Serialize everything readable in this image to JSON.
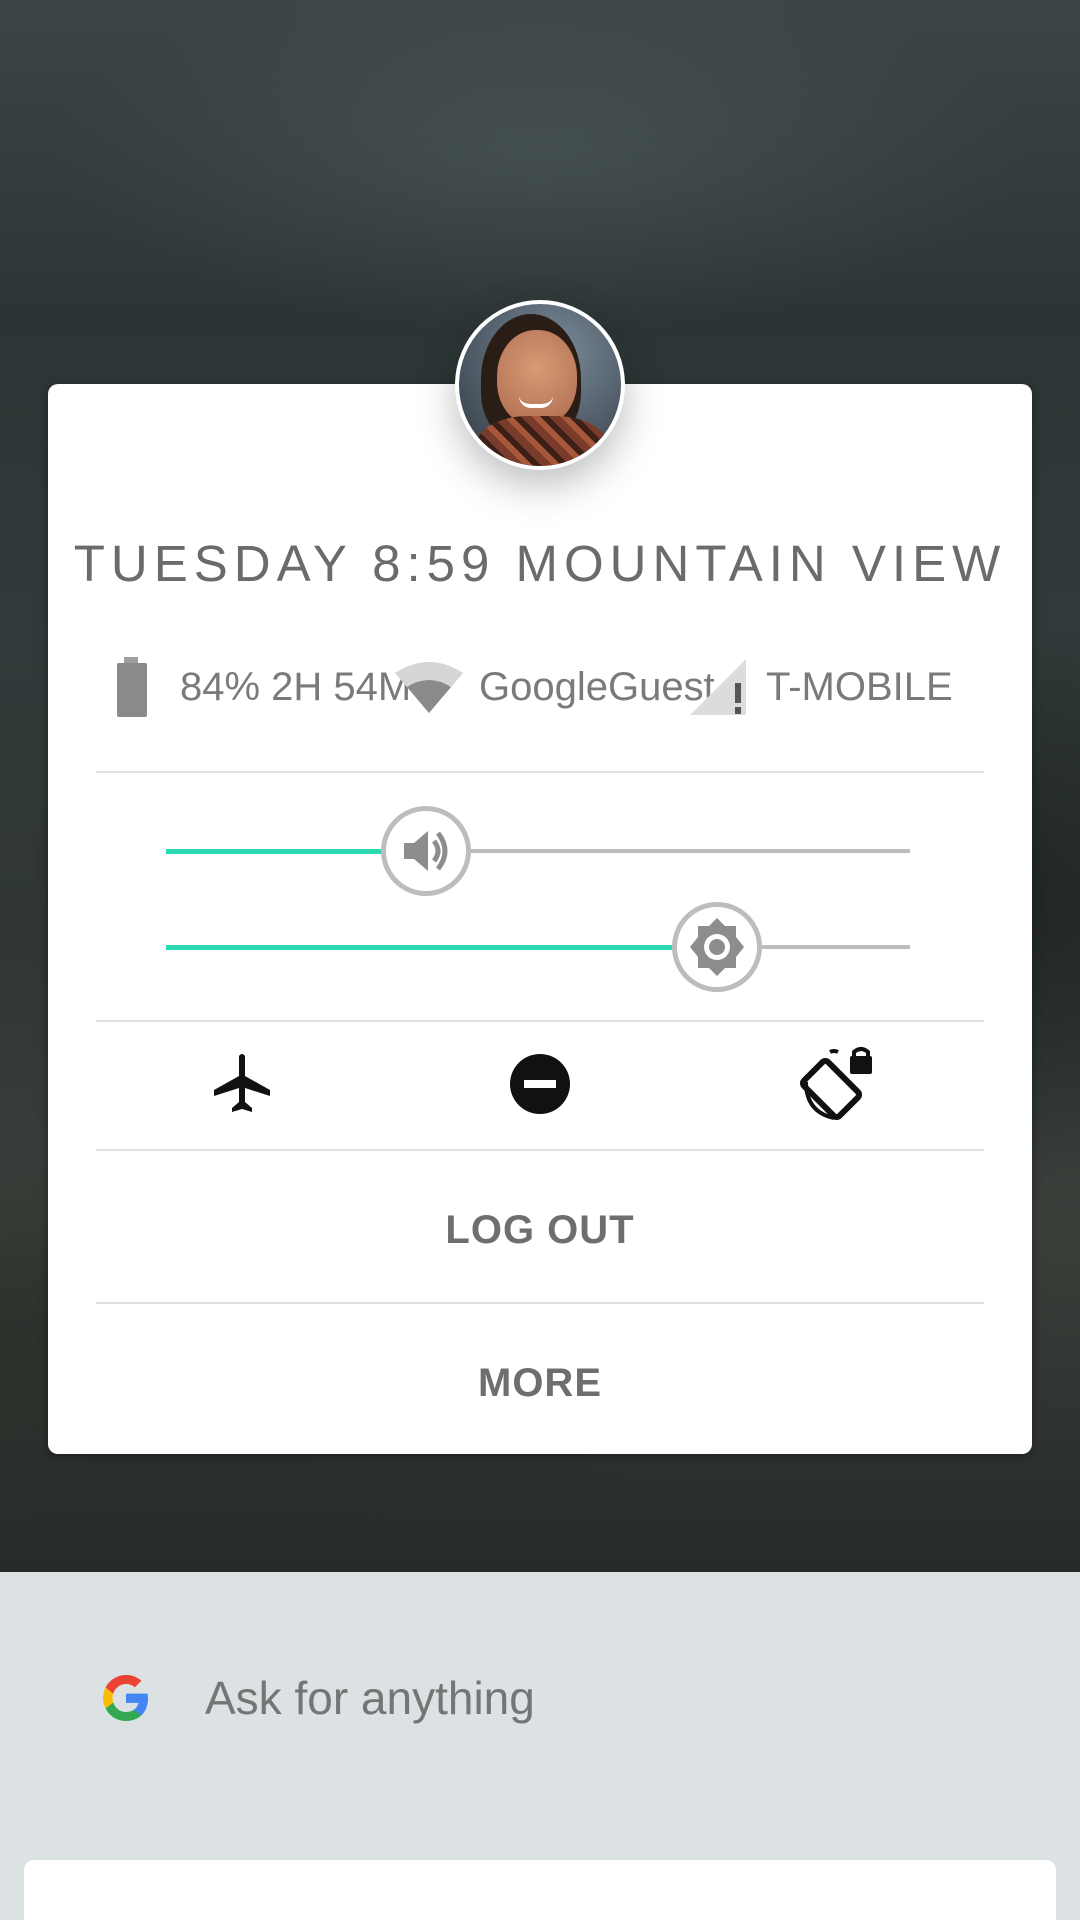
{
  "header": {
    "datetime": "TUESDAY 8:59 MOUNTAIN VIEW"
  },
  "status": {
    "battery": {
      "icon": "battery-icon",
      "text": "84% 2H 54M"
    },
    "wifi": {
      "icon": "wifi-icon",
      "text": "GoogleGuest"
    },
    "cell": {
      "icon": "cell-signal-icon",
      "text": "T-MOBILE"
    }
  },
  "sliders": {
    "volume": {
      "icon": "volume-icon",
      "level": 0.35,
      "fill_color": "#2bdab0"
    },
    "brightness": {
      "icon": "brightness-icon",
      "level": 0.74,
      "fill_color": "#2bdab0"
    }
  },
  "toggles": [
    {
      "icon": "airplane-mode-icon"
    },
    {
      "icon": "do-not-disturb-icon"
    },
    {
      "icon": "rotation-lock-icon"
    }
  ],
  "actions": {
    "logout_label": "LOG OUT",
    "more_label": "MORE"
  },
  "search": {
    "placeholder": "Ask for anything",
    "icon": "google-g-icon"
  }
}
